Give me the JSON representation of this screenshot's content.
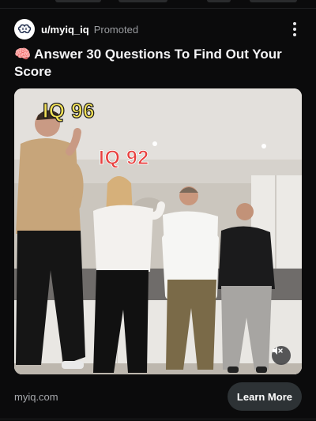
{
  "post": {
    "username": "u/myiq_iq",
    "promoted_label": "Promoted",
    "title_emoji": "🧠",
    "title": "Answer 30 Questions To Find Out Your Score",
    "media": {
      "overlay_1": "IQ 96",
      "overlay_2": "IQ 92",
      "mute_icon": "speaker-muted-icon"
    },
    "domain": "myiq.com",
    "cta_label": "Learn More"
  },
  "icons": {
    "avatar": "brain-logo-icon",
    "more": "vertical-dots-icon"
  },
  "colors": {
    "background": "#0b0b0c",
    "cta_background": "#2d3235",
    "overlay_1": "#f4e257",
    "overlay_2": "#e8403f"
  }
}
